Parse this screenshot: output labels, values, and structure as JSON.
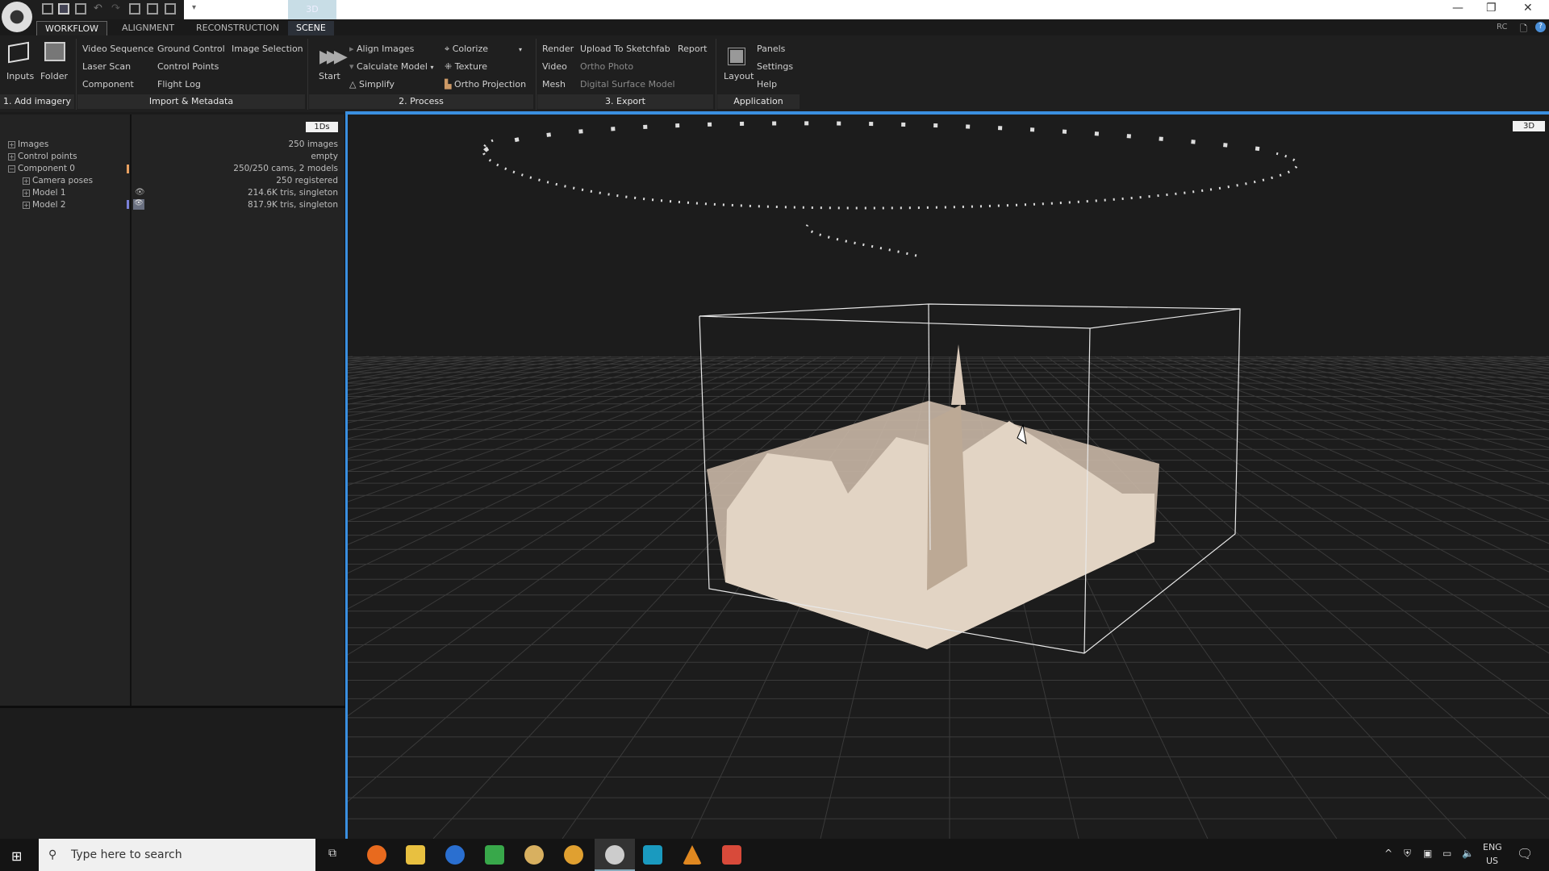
{
  "titlebar": {
    "quick_3d": "3D",
    "overlay_rc": "RC"
  },
  "tabs": [
    "WORKFLOW",
    "ALIGNMENT",
    "RECONSTRUCTION",
    "SCENE"
  ],
  "ribbon": {
    "add_imagery": {
      "inputs": "Inputs",
      "folder": "Folder",
      "label": "1. Add imagery"
    },
    "import": {
      "items": [
        "Video Sequence",
        "Ground Control",
        "Image Selection",
        "Laser Scan",
        "Control Points",
        "Component",
        "Flight Log"
      ],
      "label": "Import & Metadata"
    },
    "process": {
      "start": "Start",
      "align": "Align Images",
      "calculate": "Calculate Model",
      "simplify": "Simplify",
      "colorize": "Colorize",
      "texture": "Texture",
      "ortho_projection": "Ortho Projection",
      "label": "2. Process"
    },
    "export": {
      "render": "Render",
      "upload": "Upload To Sketchfab",
      "report": "Report",
      "video": "Video",
      "ortho_photo": "Ortho Photo",
      "mesh": "Mesh",
      "dsm": "Digital Surface Model",
      "label": "3. Export"
    },
    "application": {
      "layout": "Layout",
      "panels": "Panels",
      "settings": "Settings",
      "help": "Help",
      "label": "Application"
    }
  },
  "left_panel": {
    "view_badge": "1Ds",
    "tree": [
      {
        "name": "Images",
        "value": "250 images"
      },
      {
        "name": "Control points",
        "value": "empty"
      },
      {
        "name": "Component 0",
        "value": "250/250 cams, 2 models"
      },
      {
        "name": "Camera poses",
        "value": "250 registered"
      },
      {
        "name": "Model 1",
        "value": "214.6K tris, singleton"
      },
      {
        "name": "Model 2",
        "value": "817.9K tris, singleton"
      }
    ]
  },
  "viewport": {
    "view_badge": "3D",
    "accent": "#3a8fe0"
  },
  "taskbar": {
    "search_placeholder": "Type here to search",
    "lang": "ENG",
    "region": "US"
  }
}
